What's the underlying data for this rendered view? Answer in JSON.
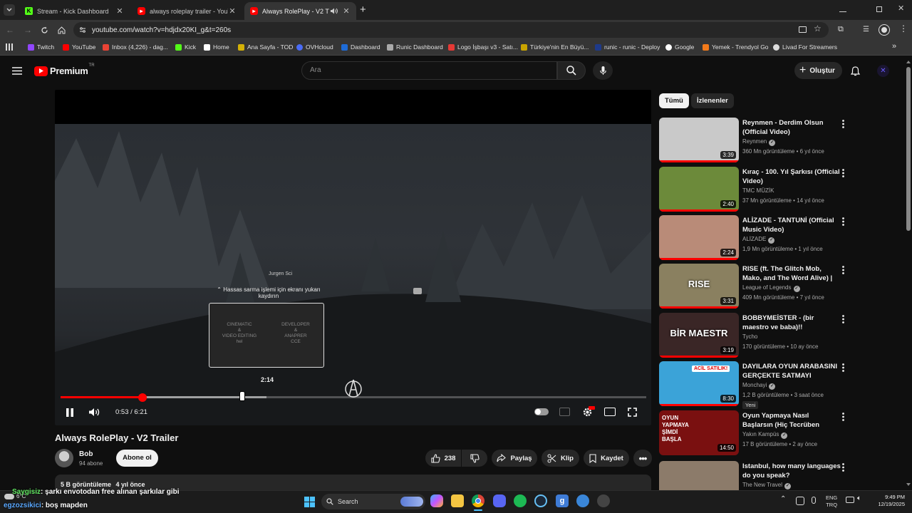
{
  "browser": {
    "tabs": [
      {
        "title": "Stream - Kick Dashboard",
        "favicon": "kick"
      },
      {
        "title": "always roleplay trailer - YouTube",
        "favicon": "youtube"
      },
      {
        "title": "Always RolePlay - V2 Trailer",
        "favicon": "youtube",
        "active": true
      }
    ],
    "url": "youtube.com/watch?v=hdjdx20KI_g&t=260s",
    "bookmarks": [
      {
        "label": "Twitch",
        "color": "#9146ff"
      },
      {
        "label": "YouTube",
        "color": "#ff0000"
      },
      {
        "label": "Inbox (4,226) - dag...",
        "color": "#ea4335"
      },
      {
        "label": "Kick",
        "color": "#53fc18"
      },
      {
        "label": "Home",
        "color": "#ffffff"
      },
      {
        "label": "Ana Sayfa - TOD",
        "color": "#d4b106"
      },
      {
        "label": "OVHcloud",
        "color": "#4a6cf7"
      },
      {
        "label": "Dashboard",
        "color": "#1e6bd6"
      },
      {
        "label": "Runic Dashboard",
        "color": "#aaaaaa"
      },
      {
        "label": "Logo İşbaşı v3 - Satı...",
        "color": "#e53935"
      },
      {
        "label": "Türkiye'nin En Büyü...",
        "color": "#c9a400"
      },
      {
        "label": "runic - runic - Deploy",
        "color": "#1e3a8a"
      },
      {
        "label": "Google",
        "color": "#ffffff"
      },
      {
        "label": "Yemek - Trendyol Go",
        "color": "#f27a1a"
      },
      {
        "label": "Livad For Streamers",
        "color": "#dddddd"
      }
    ]
  },
  "youtube": {
    "logo_text": "Premium",
    "logo_badge": "TR",
    "search_placeholder": "Ara",
    "create_label": "Oluştur"
  },
  "player": {
    "time_current": "0:53",
    "time_total": "6:21",
    "time_display": "0:53 / 6:21",
    "progress": 0.14,
    "buffered": 0.352,
    "hover_time": "2:14",
    "hint_name": "Jurgen Sci",
    "hint_text_1": "Hassas sarma işlemi için ekranı yukarı",
    "hint_text_2": "kaydırın",
    "preview_left_1": "CINEMATIC",
    "preview_left_2": "&",
    "preview_left_3": "VIDEO EDITING",
    "preview_left_4": "hel",
    "preview_right_1": "DEVELOPER",
    "preview_right_2": "&",
    "preview_right_3": "ANAPRER",
    "preview_right_4": "CCE"
  },
  "video": {
    "title": "Always RolePlay - V2 Trailer",
    "channel": "Bob",
    "subscribers": "94 abone",
    "subscribe_label": "Abone ol",
    "likes": "238",
    "share_label": "Paylaş",
    "clip_label": "Klip",
    "save_label": "Kaydet",
    "views": "5 B görüntüleme",
    "age": "4 yıl önce"
  },
  "sidebar": {
    "chips": [
      "Tümü",
      "İzlenenler"
    ],
    "recommendations": [
      {
        "title": "Reynmen - Derdim Olsun (Official Video)",
        "channel": "Reynmen",
        "meta": "360 Mn görüntüleme • 6 yıl önce",
        "duration": "3:39",
        "verified": true,
        "thumb": "#c9c9c9"
      },
      {
        "title": "Kıraç - 100. Yıl Şarkısı (Official Video)",
        "channel": "TMC MÜZİK",
        "meta": "37 Mn görüntüleme • 14 yıl önce",
        "duration": "2:40",
        "verified": false,
        "thumb": "#6c8a3a"
      },
      {
        "title": "ALİZADE - TANTUNİ (Official Music Video)",
        "channel": "ALİZADE",
        "meta": "1,9 Mn görüntüleme • 1 yıl önce",
        "duration": "2:24",
        "verified": true,
        "thumb": "#b98b78"
      },
      {
        "title": "RISE (ft. The Glitch Mob, Mako, and The Word Alive) | Worlds ...",
        "channel": "League of Legends",
        "meta": "409 Mn görüntüleme • 7 yıl önce",
        "duration": "3:31",
        "verified": true,
        "thumb": "#8a8060"
      },
      {
        "title": "BOBBYMEİSTER - (bir maestro ve baba)!!    @bobbymeister",
        "channel": "Tycho",
        "meta": "170 görüntüleme • 10 ay önce",
        "duration": "3:19",
        "verified": false,
        "thumb": "#3a2626"
      },
      {
        "title": "DAYILARA OYUN ARABASINI GERÇEKTE SATMAYI DENEDİM!",
        "channel": "Monchayi",
        "meta": "1,2 B görüntüleme • 3 saat önce",
        "duration": "8:30",
        "verified": true,
        "badge": "Yeni",
        "thumb": "#3ba3d8"
      },
      {
        "title": "Oyun Yapmaya Nasıl Başlarsın (Hiç Tecrüben Yoksa)",
        "channel": "Yakın Kampüs",
        "meta": "17 B görüntüleme • 2 ay önce",
        "duration": "14:50",
        "verified": true,
        "thumb": "#7a1010"
      },
      {
        "title": "Istanbul, how many languages do you speak?",
        "channel": "The New Travel",
        "meta": "",
        "duration": "",
        "verified": true,
        "thumb": "#8c7b6a"
      }
    ],
    "thumb_text_4": "BİR MAESTR",
    "thumb_text_5": "ACİL SATILIK!",
    "thumb_text_6": "OYUN YAPMAYA ŞİMDİ BAŞLA",
    "thumb_text_3": "RISE"
  },
  "overlay": {
    "chat_user_1": "Saygisiz",
    "chat_msg_1": ": şarkı envotodan free alınan şarkılar gibi",
    "chat_user_2": "egzozsikici",
    "chat_msg_2": ": boş mapden",
    "weather": "6°C"
  },
  "taskbar": {
    "search_label": "Search",
    "lang_1": "ENG",
    "lang_2": "TRQ",
    "time": "9:49 PM",
    "date": "12/19/2025"
  }
}
